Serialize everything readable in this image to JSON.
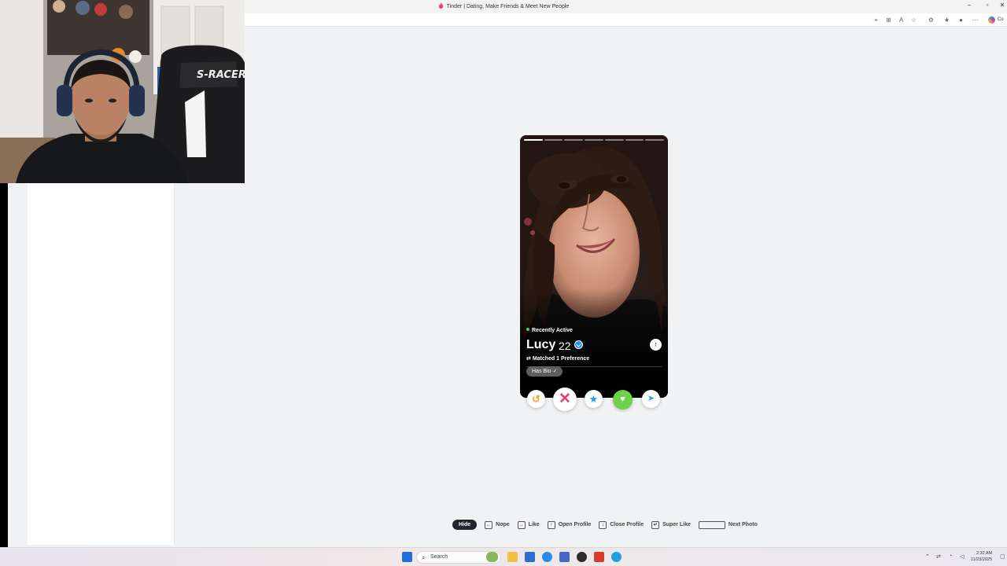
{
  "browser": {
    "tab_title": "Tinder | Dating, Make Friends & Meet New People",
    "copilot_label": "Co"
  },
  "profile": {
    "status": "Recently Active",
    "name": "Lucy",
    "age": "22",
    "matched": "Matched 1 Preference",
    "chip": "Has Bio",
    "photo_count": 7,
    "photo_index": 1
  },
  "actions": {
    "rewind_icon": "rewind-icon",
    "nope_icon": "x-icon",
    "super_like_icon": "star-icon",
    "like_icon": "heart-icon",
    "boost_icon": "send-icon"
  },
  "shortcuts": {
    "hide": "Hide",
    "nope": "Nope",
    "like": "Like",
    "open_profile": "Open Profile",
    "close_profile": "Close Profile",
    "super_like": "Super Like",
    "next_photo": "Next Photo"
  },
  "taskbar": {
    "search_placeholder": "Search",
    "time": "2:32 AM",
    "date": "11/23/2025"
  },
  "colors": {
    "nope": "#e93c74",
    "super_like": "#1fa3e0",
    "like": "#6cd34a",
    "rewind": "#f5a623"
  }
}
